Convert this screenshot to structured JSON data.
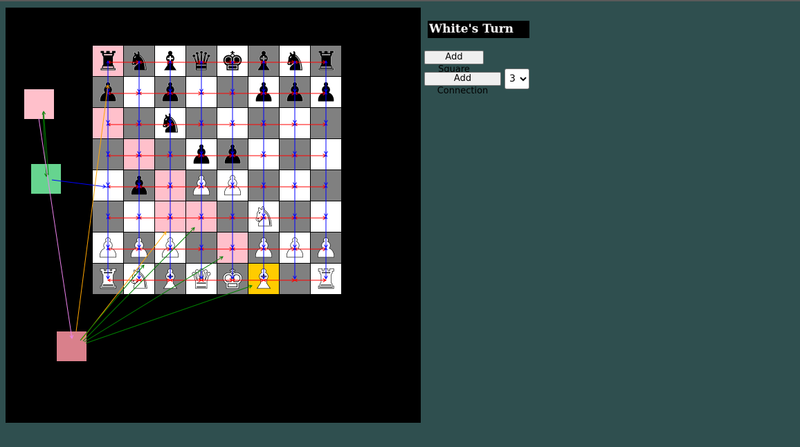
{
  "turn_label": "White's Turn",
  "controls": {
    "add_square_label": "Add Square",
    "add_connection_label": "Add Connection",
    "connection_select_value": "3",
    "connection_options": [
      "3"
    ]
  },
  "board": {
    "rows": [
      [
        "bR",
        "bN",
        "bB",
        "bQ",
        "bK",
        "bB",
        "bN",
        "bR"
      ],
      [
        "bP",
        "",
        "bP",
        "",
        "",
        "bP",
        "bP",
        "bP"
      ],
      [
        "",
        "",
        "bN",
        "",
        "",
        "",
        "",
        ""
      ],
      [
        "",
        "",
        "",
        "bP",
        "bP",
        "",
        "",
        ""
      ],
      [
        "",
        "bP",
        "",
        "wP",
        "wP",
        "",
        "",
        ""
      ],
      [
        "",
        "",
        "",
        "",
        "",
        "wN",
        "",
        ""
      ],
      [
        "wP",
        "wP",
        "wP",
        "",
        "",
        "wP",
        "wP",
        "wP"
      ],
      [
        "wR",
        "wN",
        "wB",
        "wQ",
        "wK",
        "wB",
        "",
        "wR"
      ]
    ],
    "highlighted_squares": [
      {
        "row": 0,
        "col": 0,
        "color": "pink"
      },
      {
        "row": 2,
        "col": 0,
        "color": "pink"
      },
      {
        "row": 3,
        "col": 1,
        "color": "pink"
      },
      {
        "row": 4,
        "col": 2,
        "color": "pink"
      },
      {
        "row": 5,
        "col": 2,
        "color": "pink"
      },
      {
        "row": 5,
        "col": 3,
        "color": "pink"
      },
      {
        "row": 6,
        "col": 4,
        "color": "pink"
      },
      {
        "row": 7,
        "col": 5,
        "color": "gold"
      }
    ],
    "colors": {
      "light": "#ffffff",
      "dark": "#808080",
      "pink": "#ffc0cb",
      "gold": "#ffcc00",
      "row_connection": "#ff0000",
      "col_connection": "#0000ff"
    }
  },
  "extra_squares": [
    {
      "id": "pink-square",
      "color": "#ffc0cb"
    },
    {
      "id": "green-square",
      "color": "#66d48f"
    },
    {
      "id": "rose-square",
      "color": "#d9808b"
    }
  ],
  "extra_connections": [
    {
      "from": "pink-square",
      "to": "green-square",
      "color": "#008000"
    },
    {
      "from": "green-square",
      "to": "pink-square",
      "color": "#008000"
    },
    {
      "from": "green-square",
      "to": "board-a4",
      "color": "#0000ff"
    },
    {
      "from": "pink-square",
      "to": "rose-square",
      "color": "#ee82ee"
    },
    {
      "from": "rose-square",
      "to": "board-a7",
      "color": "#ffa500"
    },
    {
      "from": "rose-square",
      "to": "board-c2",
      "color": "#ffa500"
    },
    {
      "from": "rose-square",
      "to": "board-d3",
      "color": "#008000"
    },
    {
      "from": "rose-square",
      "to": "board-e2",
      "color": "#008000"
    },
    {
      "from": "rose-square",
      "to": "board-f1",
      "color": "#008000"
    },
    {
      "from": "rose-square",
      "to": "board-b1",
      "color": "#008000"
    }
  ]
}
